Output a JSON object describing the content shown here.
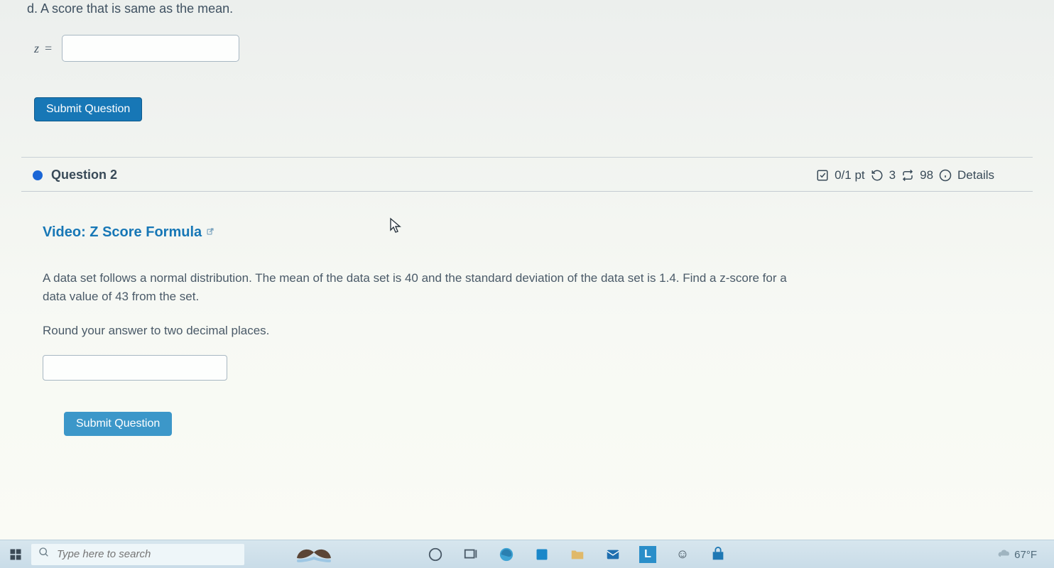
{
  "q1": {
    "prompt": "d. A score that is same as the mean.",
    "z_label": "z",
    "eq": "=",
    "input_value": "",
    "submit_label": "Submit Question"
  },
  "q2": {
    "header": {
      "title": "Question 2",
      "score": "0/1 pt",
      "attemptsLeft": "3",
      "attemptsTotal": "98",
      "details": "Details"
    },
    "video_link": "Video: Z Score Formula",
    "problem": "A data set follows a normal distribution. The mean of the data set is 40 and the standard deviation of the data set is 1.4. Find a z-score for a data value of 43 from the set.",
    "round_note": "Round your answer to two decimal places.",
    "input_value": "",
    "submit_label": "Submit Question"
  },
  "taskbar": {
    "search_placeholder": "Type here to search",
    "weather": "67°F"
  }
}
